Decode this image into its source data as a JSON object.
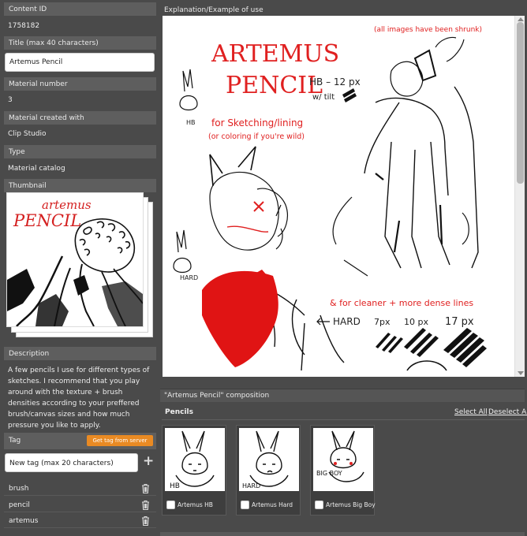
{
  "left_panel": {
    "content_id": {
      "label": "Content ID",
      "value": "1758182"
    },
    "title": {
      "label": "Title (max 40 characters)",
      "value": "Artemus Pencil"
    },
    "material_number": {
      "label": "Material number",
      "value": "3"
    },
    "created_with": {
      "label": "Material created with",
      "value": "Clip Studio"
    },
    "type": {
      "label": "Type",
      "value": "Material catalog"
    },
    "thumbnail": {
      "label": "Thumbnail",
      "image_text_1": "artemus",
      "image_text_2": "PENCIL"
    },
    "description": {
      "label": "Description",
      "text": "A few pencils I use for different types of sketches. I recommend that you play around with the texture + brush densities according to your preffered brush/canvas sizes and how much pressure you like to apply."
    },
    "tag": {
      "label": "Tag",
      "get_tag_button": "Get tag from server",
      "new_tag_placeholder": "New tag (max 20 characters)",
      "add_icon": "plus-icon",
      "items": [
        {
          "label": "brush",
          "icon": "trash-icon"
        },
        {
          "label": "pencil",
          "icon": "trash-icon"
        },
        {
          "label": "artemus",
          "icon": "trash-icon"
        }
      ]
    }
  },
  "explanation": {
    "label": "Explanation/Example of use",
    "image_texts": {
      "title_1": "ARTEMUS",
      "title_2": "PENCIL",
      "note": "(all images have been shrunk)",
      "hb_size": "HB – 12 px",
      "tilt": "w/ tilt",
      "hb": "HB",
      "use_1": "for Sketching/lining",
      "use_2": "(or coloring if you're wild)",
      "hard": "HARD",
      "cleaner": "& for cleaner + more dense lines",
      "hard_arrow": "HARD",
      "size_7": "7px",
      "size_10": "10 px",
      "size_17": "17 px"
    }
  },
  "composition": {
    "label": "\"Artemus Pencil\" composition",
    "group_label": "Pencils",
    "select_all": "Select All",
    "deselect_all": "Deselect All",
    "items": [
      {
        "name": "Artemus HB",
        "tag": "HB"
      },
      {
        "name": "Artemus Hard",
        "tag": "HARD"
      },
      {
        "name": "Artemus Big Boy",
        "tag": "BIG BOY"
      }
    ]
  },
  "colors": {
    "accent_orange": "#e98a23",
    "ink_red": "#e02020",
    "panel_bg": "#4a4a4a",
    "header_bg": "#5e5e5e"
  }
}
